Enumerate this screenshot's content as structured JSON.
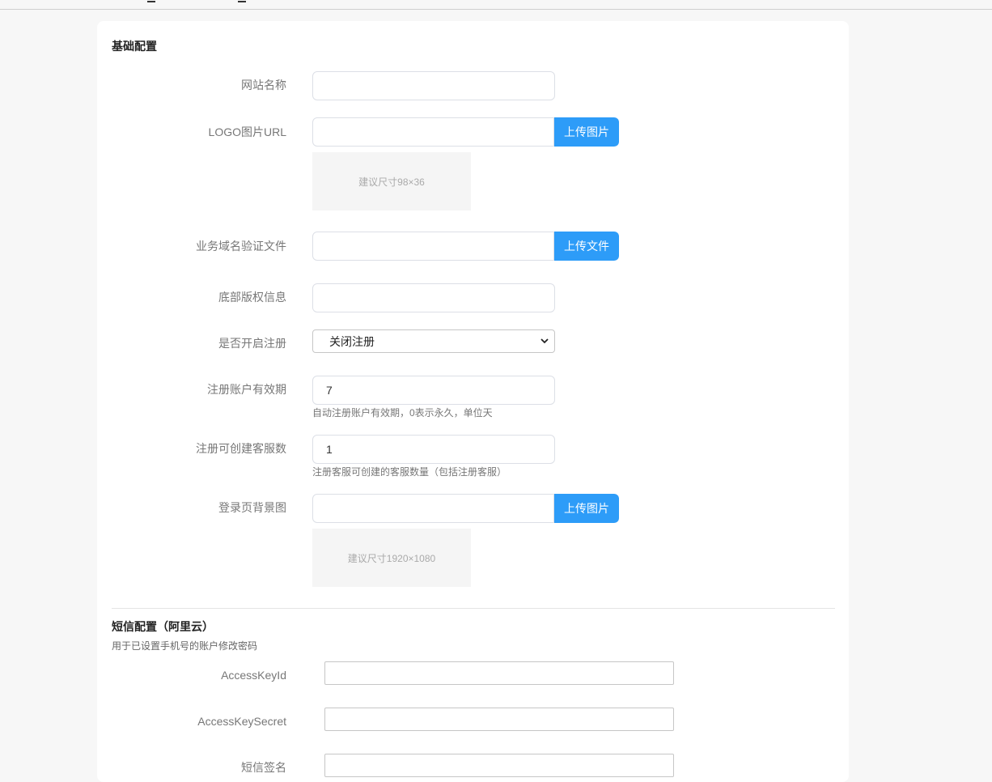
{
  "basic": {
    "title": "基础配置",
    "site_name_label": "网站名称",
    "site_name_value": "",
    "logo_label": "LOGO图片URL",
    "logo_value": "",
    "logo_upload_btn": "上传图片",
    "logo_preview_text": "建议尺寸98×36",
    "domain_file_label": "业务域名验证文件",
    "domain_file_value": "",
    "domain_upload_btn": "上传文件",
    "copyright_label": "底部版权信息",
    "copyright_value": "",
    "register_label": "是否开启注册",
    "register_selected": "关闭注册",
    "validity_label": "注册账户有效期",
    "validity_value": "7",
    "validity_hint": "自动注册账户有效期，0表示永久，单位天",
    "cs_count_label": "注册可创建客服数",
    "cs_count_value": "1",
    "cs_count_hint": "注册客服可创建的客服数量（包括注册客服）",
    "login_bg_label": "登录页背景图",
    "login_bg_value": "",
    "login_bg_upload_btn": "上传图片",
    "login_bg_preview_text": "建议尺寸1920×1080"
  },
  "sms": {
    "title": "短信配置（阿里云）",
    "desc": "用于已设置手机号的账户修改密码",
    "access_key_id_label": "AccessKeyId",
    "access_key_secret_label": "AccessKeySecret",
    "sign_label": "短信签名"
  },
  "colors": {
    "primary_button": "#2d9cf8",
    "page_bg": "#f7f7f7",
    "card_bg": "#ffffff"
  }
}
